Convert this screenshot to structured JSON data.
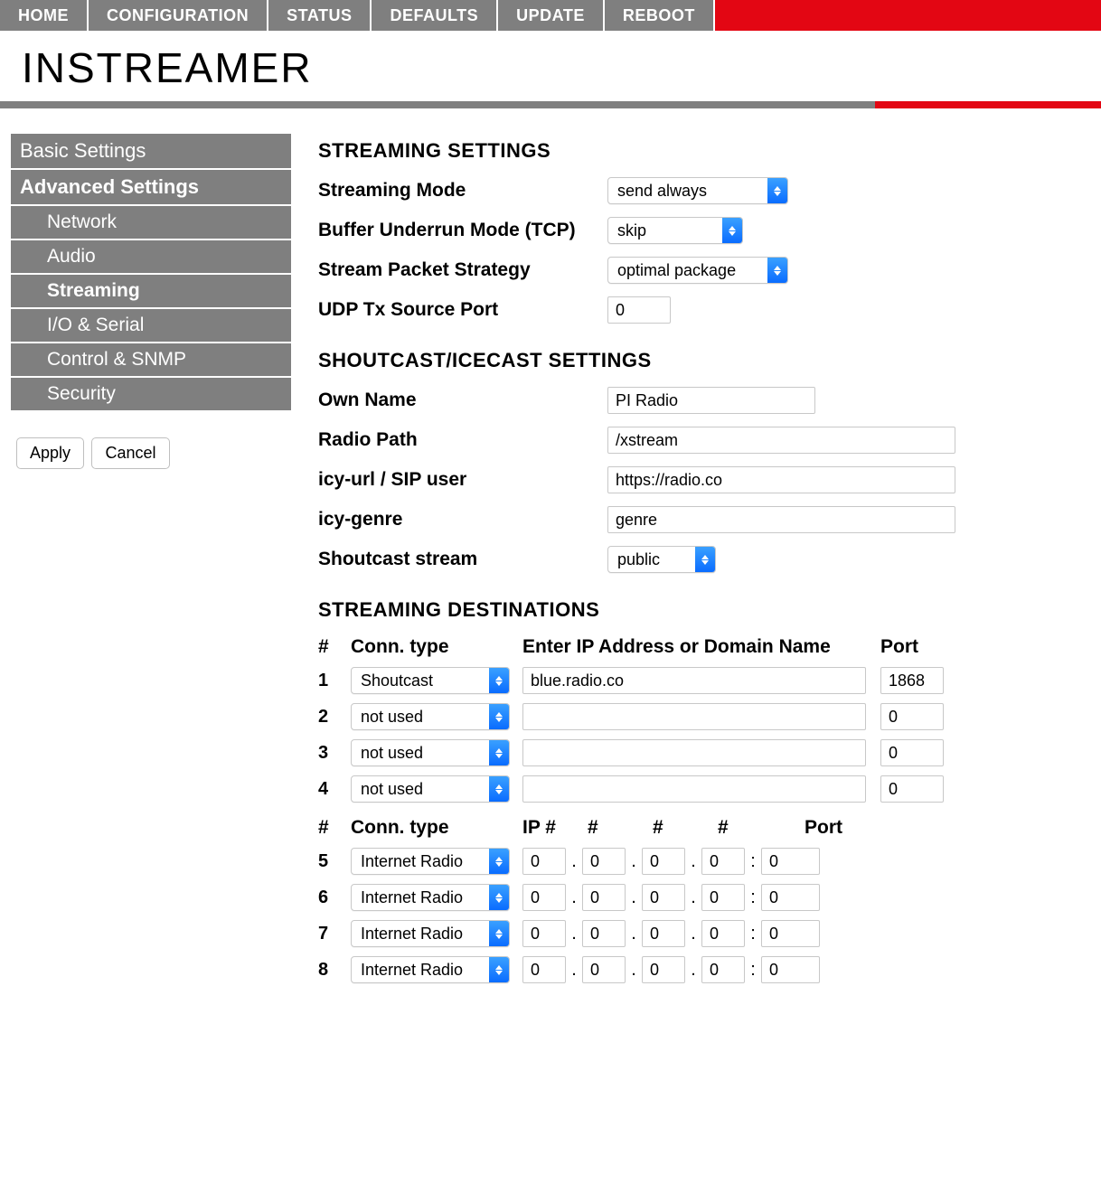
{
  "topnav": [
    "HOME",
    "CONFIGURATION",
    "STATUS",
    "DEFAULTS",
    "UPDATE",
    "REBOOT"
  ],
  "page_title": "INSTREAMER",
  "sidebar": {
    "groups": [
      {
        "label": "Basic Settings",
        "bold": false
      },
      {
        "label": "Advanced Settings",
        "bold": true
      }
    ],
    "subs": [
      {
        "label": "Network",
        "active": false
      },
      {
        "label": "Audio",
        "active": false
      },
      {
        "label": "Streaming",
        "active": true
      },
      {
        "label": "I/O & Serial",
        "active": false
      },
      {
        "label": "Control & SNMP",
        "active": false
      },
      {
        "label": "Security",
        "active": false
      }
    ],
    "apply": "Apply",
    "cancel": "Cancel"
  },
  "sections": {
    "streaming_settings_title": "STREAMING SETTINGS",
    "shoutcast_title": "SHOUTCAST/ICECAST SETTINGS",
    "destinations_title": "STREAMING DESTINATIONS"
  },
  "streaming": {
    "mode_label": "Streaming Mode",
    "mode_value": "send always",
    "underrun_label": "Buffer Underrun Mode (TCP)",
    "underrun_value": "skip",
    "packet_label": "Stream Packet Strategy",
    "packet_value": "optimal package",
    "udp_label": "UDP Tx Source Port",
    "udp_value": "0"
  },
  "shoutcast": {
    "own_name_label": "Own Name",
    "own_name_value": "PI Radio",
    "radio_path_label": "Radio Path",
    "radio_path_value": "/xstream",
    "icy_url_label": "icy-url / SIP user",
    "icy_url_value": "https://radio.co",
    "icy_genre_label": "icy-genre",
    "icy_genre_value": "genre",
    "stream_label": "Shoutcast stream",
    "stream_value": "public"
  },
  "dest_headers1": {
    "num": "#",
    "conn": "Conn. type",
    "addr": "Enter IP Address or Domain Name",
    "port": "Port"
  },
  "dest_rows1": [
    {
      "num": "1",
      "conn": "Shoutcast",
      "addr": "blue.radio.co",
      "port": "1868"
    },
    {
      "num": "2",
      "conn": "not used",
      "addr": "",
      "port": "0"
    },
    {
      "num": "3",
      "conn": "not used",
      "addr": "",
      "port": "0"
    },
    {
      "num": "4",
      "conn": "not used",
      "addr": "",
      "port": "0"
    }
  ],
  "dest_headers2": {
    "num": "#",
    "conn": "Conn. type",
    "ip": "IP #",
    "hash": "#",
    "port": "Port"
  },
  "dest_rows2": [
    {
      "num": "5",
      "conn": "Internet Radio",
      "ip": [
        "0",
        "0",
        "0",
        "0"
      ],
      "port": "0"
    },
    {
      "num": "6",
      "conn": "Internet Radio",
      "ip": [
        "0",
        "0",
        "0",
        "0"
      ],
      "port": "0"
    },
    {
      "num": "7",
      "conn": "Internet Radio",
      "ip": [
        "0",
        "0",
        "0",
        "0"
      ],
      "port": "0"
    },
    {
      "num": "8",
      "conn": "Internet Radio",
      "ip": [
        "0",
        "0",
        "0",
        "0"
      ],
      "port": "0"
    }
  ],
  "separators": {
    "dot": ".",
    "colon": ":"
  }
}
